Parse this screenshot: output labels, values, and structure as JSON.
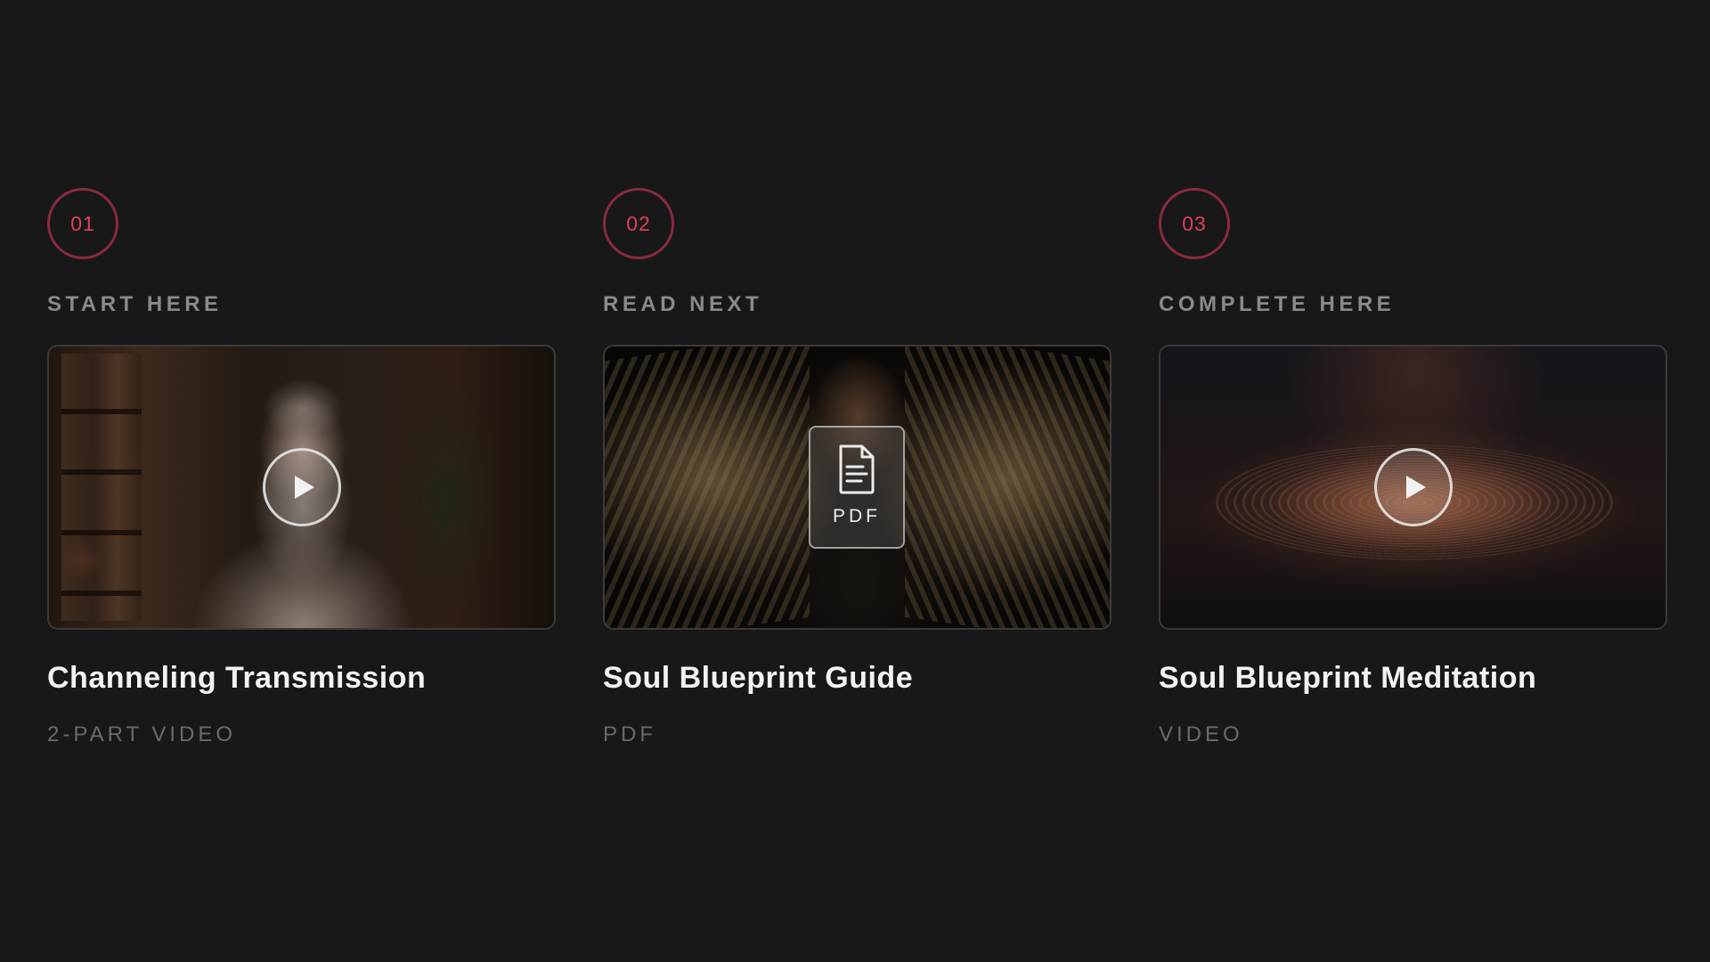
{
  "theme": {
    "background": "#181818",
    "accent": "#e23d5e",
    "accent_ring": "#8a2a3d",
    "title_color": "#f2f2f2",
    "muted": "#8a8a8a"
  },
  "cards": [
    {
      "step": "01",
      "eyebrow": "START HERE",
      "title": "Channeling Transmission",
      "meta": "2-PART VIDEO",
      "media_type": "video",
      "overlay_icon": "play-icon"
    },
    {
      "step": "02",
      "eyebrow": "READ NEXT",
      "title": "Soul Blueprint Guide",
      "meta": "PDF",
      "media_type": "pdf",
      "overlay_icon": "document-icon",
      "overlay_label": "PDF"
    },
    {
      "step": "03",
      "eyebrow": "COMPLETE HERE",
      "title": "Soul Blueprint Meditation",
      "meta": "VIDEO",
      "media_type": "video",
      "overlay_icon": "play-icon"
    }
  ]
}
